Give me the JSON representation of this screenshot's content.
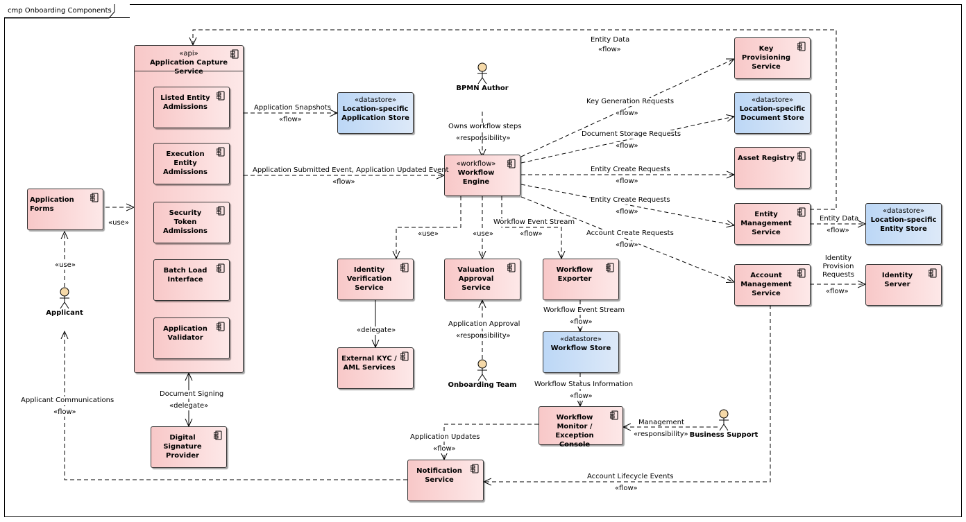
{
  "diagram": {
    "frame_title": "cmp Onboarding Components",
    "colors": {
      "component_fill": "#f8c8c8",
      "datastore_fill": "#bcd7f6",
      "actor_fill": "#f5d9a8",
      "stroke": "#000000"
    }
  },
  "nodes": {
    "app_capture": {
      "stereotype": "«api»",
      "name": "Application Capture Service"
    },
    "listed_entity": {
      "name": "Listed Entity Admissions"
    },
    "execution_entity": {
      "name": "Execution Entity Admissions"
    },
    "security_token": {
      "name": "Security Token Admissions"
    },
    "batch_load": {
      "name": "Batch Load Interface"
    },
    "app_validator": {
      "name": "Application Validator"
    },
    "app_forms": {
      "name": "Application Forms"
    },
    "digital_signature": {
      "name": "Digital Signature Provider"
    },
    "app_store": {
      "stereotype": "«datastore»",
      "name": "Location-specific Application Store"
    },
    "workflow_engine": {
      "stereotype": "«workflow»",
      "name": "Workflow Engine"
    },
    "identity_verification": {
      "name": "Identity Verification Service"
    },
    "valuation_approval": {
      "name": "Valuation Approval Service"
    },
    "workflow_exporter": {
      "name": "Workflow Exporter"
    },
    "external_kyc": {
      "name": "External KYC / AML Services"
    },
    "workflow_store": {
      "stereotype": "«datastore»",
      "name": "Workflow Store"
    },
    "workflow_monitor": {
      "name": "Workflow Monitor / Exception Console"
    },
    "notification": {
      "name": "Notification Service"
    },
    "key_provisioning": {
      "name": "Key Provisioning Service"
    },
    "document_store": {
      "stereotype": "«datastore»",
      "name": "Location-specific Document Store"
    },
    "asset_registry": {
      "name": "Asset Registry"
    },
    "entity_management": {
      "name": "Entity Management Service"
    },
    "entity_store": {
      "stereotype": "«datastore»",
      "name": "Location-specific Entity Store"
    },
    "account_management": {
      "name": "Account Management Service"
    },
    "identity_server": {
      "name": "Identity Server"
    }
  },
  "actors": {
    "applicant": "Applicant",
    "bpmn_author": "BPMN Author",
    "onboarding_team": "Onboarding Team",
    "business_support": "Business Support"
  },
  "connectors": {
    "forms_use": {
      "stereo": "«use»"
    },
    "applicant_use": {
      "stereo": "«use»"
    },
    "app_snapshots": {
      "label": "Application Snapshots",
      "stereo": "«flow»"
    },
    "app_events": {
      "label": "Application Submitted Event, Application Updated Event",
      "stereo": "«flow»"
    },
    "owns_steps": {
      "label": "Owns workflow steps",
      "stereo": "«responsibility»"
    },
    "use_identity": {
      "stereo": "«use»"
    },
    "use_valuation": {
      "stereo": "«use»"
    },
    "event_stream_1": {
      "label": "Workflow Event Stream",
      "stereo": "«flow»"
    },
    "delegate_kyc": {
      "stereo": "«delegate»"
    },
    "app_approval": {
      "label": "Application Approval",
      "stereo": "«responsibility»"
    },
    "event_stream_2": {
      "label": "Workflow Event Stream",
      "stereo": "«flow»"
    },
    "status_info": {
      "label": "Workflow Status Information",
      "stereo": "«flow»"
    },
    "management": {
      "label": "Management",
      "stereo": "«responsibility»"
    },
    "app_updates": {
      "label": "Application Updates",
      "stereo": "«flow»"
    },
    "lifecycle_events": {
      "label": "Account Lifecycle Events",
      "stereo": "«flow»"
    },
    "applicant_comms": {
      "label": "Applicant Communications",
      "stereo": "«flow»"
    },
    "doc_signing": {
      "label": "Document Signing",
      "stereo": "«delegate»"
    },
    "entity_data_top": {
      "label": "Entity Data",
      "stereo": "«flow»"
    },
    "key_gen": {
      "label": "Key Generation Requests",
      "stereo": "«flow»"
    },
    "doc_storage": {
      "label": "Document Storage Requests",
      "stereo": "«flow»"
    },
    "entity_create_1": {
      "label": "Entity Create Requests",
      "stereo": "«flow»"
    },
    "entity_create_2": {
      "label": "Entity Create Requests",
      "stereo": "«flow»"
    },
    "account_create": {
      "label": "Account Create Requests",
      "stereo": "«flow»"
    },
    "entity_data": {
      "label": "Entity Data",
      "stereo": "«flow»"
    },
    "identity_provision": {
      "label": "Identity Provision Requests",
      "stereo": "«flow»"
    }
  }
}
